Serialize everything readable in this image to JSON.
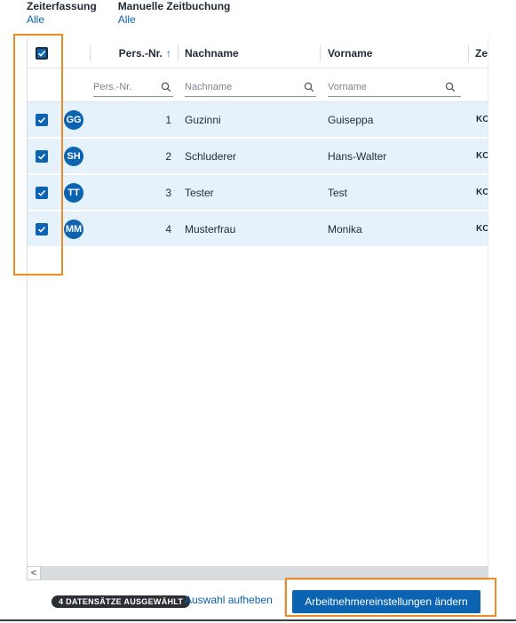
{
  "filters": [
    {
      "title": "Zeiterfassung",
      "value": "Alle"
    },
    {
      "title": "Manuelle Zeitbuchung",
      "value": "Alle"
    }
  ],
  "table": {
    "headers": {
      "pers_nr": "Pers.-Nr.",
      "sort_indicator": "↑",
      "nachname": "Nachname",
      "vorname": "Vorname",
      "zeit": "Zeit"
    },
    "filter_placeholders": {
      "pers_nr": "Pers.-Nr.",
      "nachname": "Nachname",
      "vorname": "Vorname"
    },
    "rows": [
      {
        "initials": "GG",
        "nr": "1",
        "nachname": "Guzinni",
        "vorname": "Guiseppa",
        "tag": "KO",
        "selected": true
      },
      {
        "initials": "SH",
        "nr": "2",
        "nachname": "Schluderer",
        "vorname": "Hans-Walter",
        "tag": "KO",
        "selected": true
      },
      {
        "initials": "TT",
        "nr": "3",
        "nachname": "Tester",
        "vorname": "Test",
        "tag": "KO",
        "selected": true
      },
      {
        "initials": "MM",
        "nr": "4",
        "nachname": "Musterfrau",
        "vorname": "Monika",
        "tag": "KO",
        "selected": true
      }
    ]
  },
  "scrollbar": {
    "left_arrow": "<"
  },
  "footer": {
    "selected_badge": "4 DATENSÄTZE AUSGEWÄHLT",
    "clear_selection": "Auswahl aufheben",
    "primary_action": "Arbeitnehmereinstellungen ändern"
  },
  "colors": {
    "accent": "#0b63b1",
    "row_selected": "#e5f1fb",
    "highlight": "#f08a24",
    "badge": "#2b2f33"
  },
  "icons": {
    "checkbox": "check-icon",
    "filter": "search-icon",
    "sort": "arrow-up-icon"
  }
}
